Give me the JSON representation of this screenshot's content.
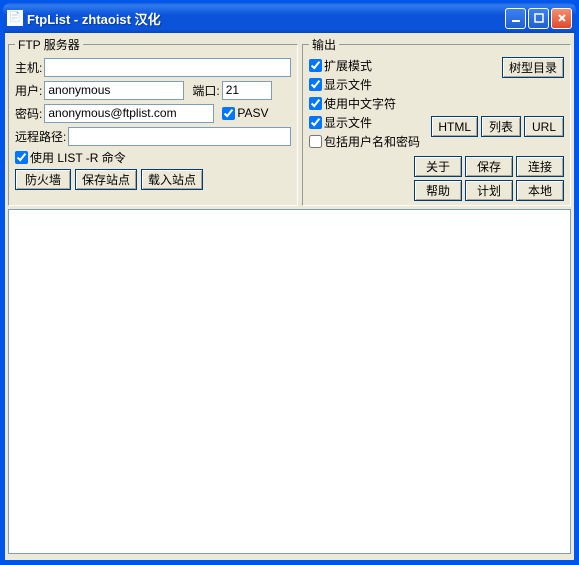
{
  "window": {
    "title": "FtpList - zhtaoist 汉化"
  },
  "ftpServer": {
    "legend": "FTP 服务器",
    "hostLabel": "主机:",
    "hostValue": "",
    "userLabel": "用户:",
    "userValue": "anonymous",
    "portLabel": "端口:",
    "portValue": "21",
    "passLabel": "密码:",
    "passValue": "anonymous@ftplist.com",
    "pasvLabel": " PASV",
    "remotePathLabel": "远程路径:",
    "remotePathValue": "",
    "useListRLabel": " 使用 LIST -R 命令",
    "buttons": {
      "firewall": "防火墙",
      "saveSite": "保存站点",
      "loadSite": "载入站点"
    }
  },
  "output": {
    "legend": "输出",
    "checkboxes": {
      "extMode": "扩展模式",
      "showFiles1": "显示文件",
      "useChinese": "使用中文字符",
      "showFiles2": "显示文件",
      "includeUserPass": "包括用户名和密码"
    },
    "treeBtn": "树型目录",
    "buttons": {
      "html": "HTML",
      "list": "列表",
      "url": "URL",
      "about": "关于",
      "save": "保存",
      "connect": "连接",
      "help": "帮助",
      "plan": "计划",
      "local": "本地"
    }
  }
}
